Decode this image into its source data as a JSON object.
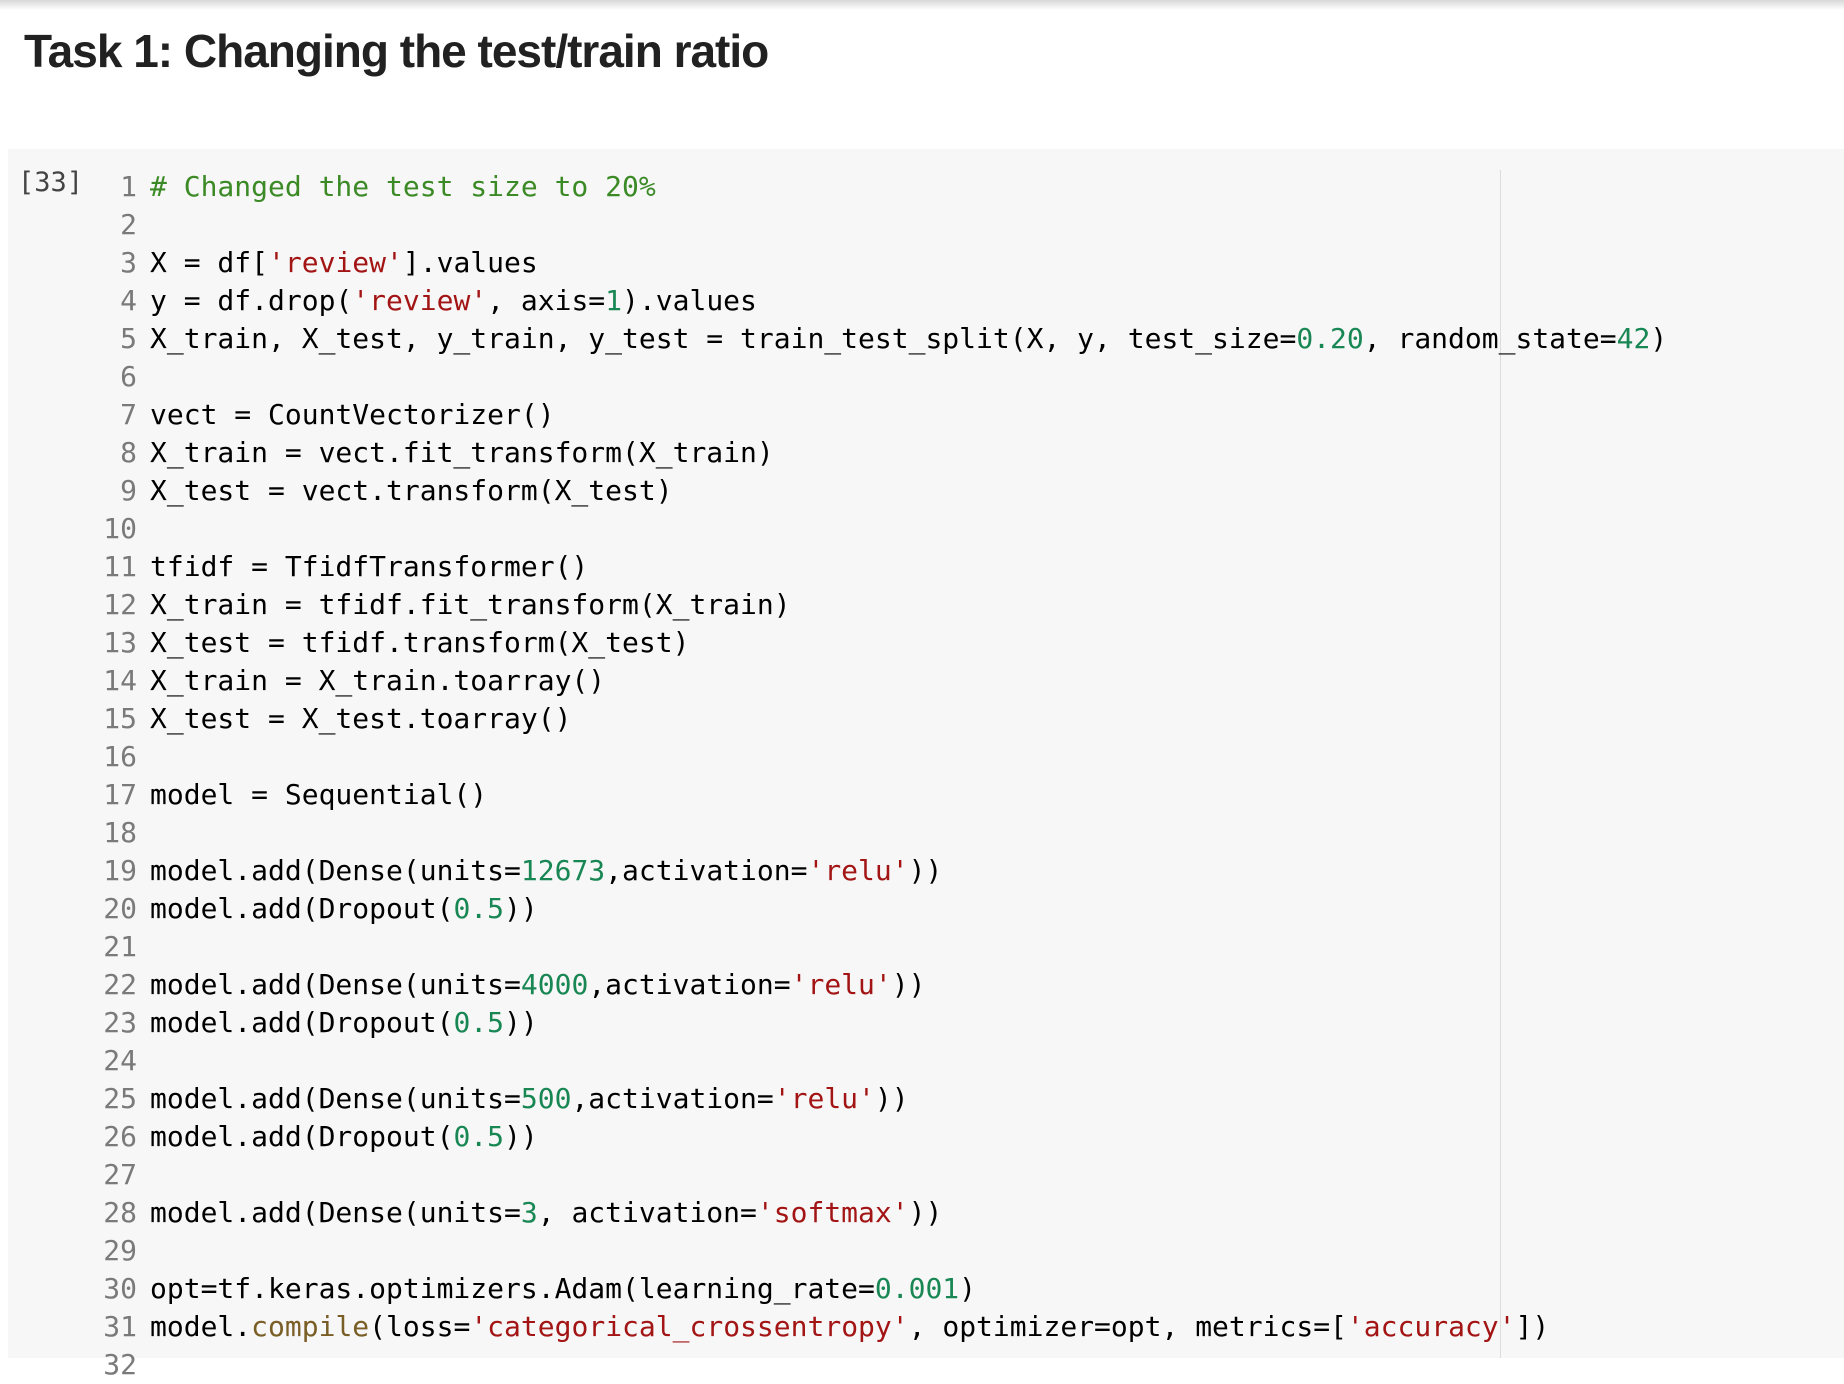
{
  "heading": "Task 1: Changing the test/train ratio",
  "cell": {
    "execution_count": "[33]",
    "colors": {
      "comment": "#3b8a26",
      "string": "#a31515",
      "number": "#198754",
      "function": "#795e26",
      "background": "#f7f7f7"
    },
    "lines": [
      {
        "n": "1",
        "tokens": [
          [
            "# Changed the test size to 20%",
            "cm"
          ]
        ]
      },
      {
        "n": "2",
        "tokens": []
      },
      {
        "n": "3",
        "tokens": [
          [
            "X = df[",
            ""
          ],
          [
            "'review'",
            "st"
          ],
          [
            "].values",
            ""
          ]
        ]
      },
      {
        "n": "4",
        "tokens": [
          [
            "y = df.drop(",
            ""
          ],
          [
            "'review'",
            "st"
          ],
          [
            ", axis=",
            ""
          ],
          [
            "1",
            "nu"
          ],
          [
            ").values",
            ""
          ]
        ]
      },
      {
        "n": "5",
        "tokens": [
          [
            "X_train, X_test, y_train, y_test = train_test_split(X, y, test_size=",
            ""
          ],
          [
            "0.20",
            "nu"
          ],
          [
            ", random_state=",
            ""
          ],
          [
            "42",
            "nu"
          ],
          [
            ")",
            ""
          ]
        ]
      },
      {
        "n": "6",
        "tokens": []
      },
      {
        "n": "7",
        "tokens": [
          [
            "vect = CountVectorizer()",
            ""
          ]
        ]
      },
      {
        "n": "8",
        "tokens": [
          [
            "X_train = vect.fit_transform(X_train)",
            ""
          ]
        ]
      },
      {
        "n": "9",
        "tokens": [
          [
            "X_test = vect.transform(X_test)",
            ""
          ]
        ]
      },
      {
        "n": "10",
        "tokens": []
      },
      {
        "n": "11",
        "tokens": [
          [
            "tfidf = TfidfTransformer()",
            ""
          ]
        ]
      },
      {
        "n": "12",
        "tokens": [
          [
            "X_train = tfidf.fit_transform(X_train)",
            ""
          ]
        ]
      },
      {
        "n": "13",
        "tokens": [
          [
            "X_test = tfidf.transform(X_test)",
            ""
          ]
        ]
      },
      {
        "n": "14",
        "tokens": [
          [
            "X_train = X_train.toarray()",
            ""
          ]
        ]
      },
      {
        "n": "15",
        "tokens": [
          [
            "X_test = X_test.toarray()",
            ""
          ]
        ]
      },
      {
        "n": "16",
        "tokens": []
      },
      {
        "n": "17",
        "tokens": [
          [
            "model = Sequential()",
            ""
          ]
        ]
      },
      {
        "n": "18",
        "tokens": []
      },
      {
        "n": "19",
        "tokens": [
          [
            "model.add(Dense(units=",
            ""
          ],
          [
            "12673",
            "nu"
          ],
          [
            ",activation=",
            ""
          ],
          [
            "'relu'",
            "st"
          ],
          [
            "))",
            ""
          ]
        ]
      },
      {
        "n": "20",
        "tokens": [
          [
            "model.add(Dropout(",
            ""
          ],
          [
            "0.5",
            "nu"
          ],
          [
            "))",
            ""
          ]
        ]
      },
      {
        "n": "21",
        "tokens": []
      },
      {
        "n": "22",
        "tokens": [
          [
            "model.add(Dense(units=",
            ""
          ],
          [
            "4000",
            "nu"
          ],
          [
            ",activation=",
            ""
          ],
          [
            "'relu'",
            "st"
          ],
          [
            "))",
            ""
          ]
        ]
      },
      {
        "n": "23",
        "tokens": [
          [
            "model.add(Dropout(",
            ""
          ],
          [
            "0.5",
            "nu"
          ],
          [
            "))",
            ""
          ]
        ]
      },
      {
        "n": "24",
        "tokens": []
      },
      {
        "n": "25",
        "tokens": [
          [
            "model.add(Dense(units=",
            ""
          ],
          [
            "500",
            "nu"
          ],
          [
            ",activation=",
            ""
          ],
          [
            "'relu'",
            "st"
          ],
          [
            "))",
            ""
          ]
        ]
      },
      {
        "n": "26",
        "tokens": [
          [
            "model.add(Dropout(",
            ""
          ],
          [
            "0.5",
            "nu"
          ],
          [
            "))",
            ""
          ]
        ]
      },
      {
        "n": "27",
        "tokens": []
      },
      {
        "n": "28",
        "tokens": [
          [
            "model.add(Dense(units=",
            ""
          ],
          [
            "3",
            "nu"
          ],
          [
            ", activation=",
            ""
          ],
          [
            "'softmax'",
            "st"
          ],
          [
            "))",
            ""
          ]
        ]
      },
      {
        "n": "29",
        "tokens": []
      },
      {
        "n": "30",
        "tokens": [
          [
            "opt=tf.keras.optimizers.Adam(learning_rate=",
            ""
          ],
          [
            "0.001",
            "nu"
          ],
          [
            ")",
            ""
          ]
        ]
      },
      {
        "n": "31",
        "tokens": [
          [
            "model.",
            ""
          ],
          [
            "compile",
            "fn"
          ],
          [
            "(loss=",
            ""
          ],
          [
            "'categorical_crossentropy'",
            "st"
          ],
          [
            ", optimizer=opt, metrics=[",
            ""
          ],
          [
            "'accuracy'",
            "st"
          ],
          [
            "])",
            ""
          ]
        ]
      },
      {
        "n": "32",
        "tokens": []
      }
    ]
  }
}
